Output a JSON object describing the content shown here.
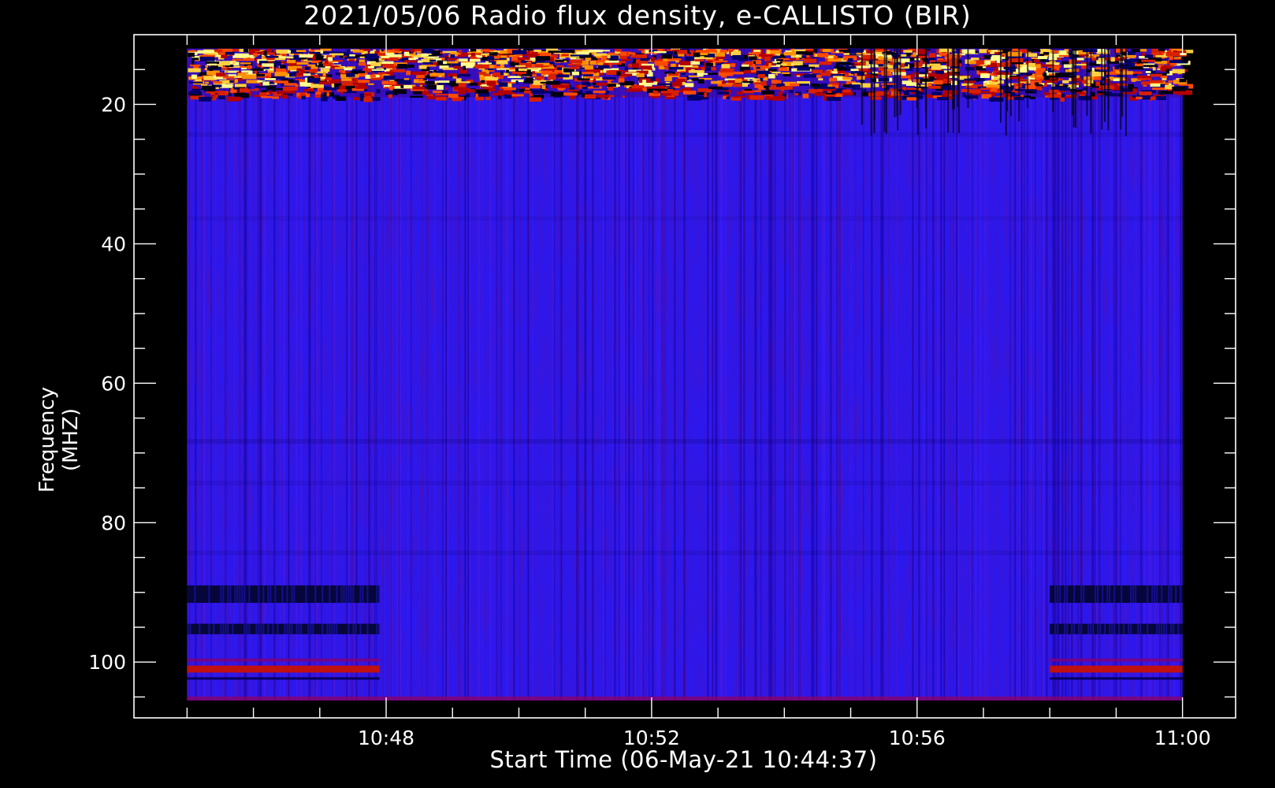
{
  "chart_data": {
    "type": "heatmap",
    "title": "2021/05/06  Radio flux density, e-CALLISTO (BIR)",
    "xlabel": "Start Time (06-May-21 10:44:37)",
    "ylabel": "Frequency (MHZ)",
    "x_ticks": [
      "10:48",
      "10:52",
      "10:56",
      "11:00"
    ],
    "x_tick_minutes": [
      648,
      652,
      656,
      660
    ],
    "x_data_range_minutes": [
      645.0,
      660.0
    ],
    "xlim_minutes": [
      644.2,
      660.8
    ],
    "y_ticks": [
      "20",
      "40",
      "60",
      "80",
      "100"
    ],
    "y_tick_values": [
      20,
      40,
      60,
      80,
      100
    ],
    "ylim": [
      10,
      108
    ],
    "y_data_range": [
      12,
      105.5
    ],
    "y_inverted": true,
    "grid": false,
    "colormap": [
      "#000000",
      "#1a00c8",
      "#2b13ff",
      "#b40000",
      "#ff3a00",
      "#ffb400",
      "#ffff90"
    ],
    "background_color": "#2a18f0",
    "features": [
      {
        "description": "bright intermittent emission band",
        "freq_range": [
          12,
          19
        ],
        "time_range": [
          645.0,
          660.0
        ],
        "intensity": "high"
      },
      {
        "description": "dark interference bands",
        "freq_range": [
          89,
          91.5
        ],
        "time_range": [
          645.0,
          647.9
        ],
        "intensity": "low"
      },
      {
        "description": "dark interference bands",
        "freq_range": [
          89,
          91.5
        ],
        "time_range": [
          658.0,
          660.0
        ],
        "intensity": "low"
      },
      {
        "description": "dark interference band",
        "freq_range": [
          94.5,
          96
        ],
        "time_range": [
          645.0,
          647.9
        ],
        "intensity": "low"
      },
      {
        "description": "dark interference band",
        "freq_range": [
          94.5,
          96
        ],
        "time_range": [
          658.0,
          660.0
        ],
        "intensity": "low"
      },
      {
        "description": "red emission line",
        "freq_range": [
          100.5,
          101.5
        ],
        "time_range": [
          645.0,
          647.9
        ],
        "intensity": "medium"
      },
      {
        "description": "red emission line",
        "freq_range": [
          100.5,
          101.5
        ],
        "time_range": [
          658.0,
          660.0
        ],
        "intensity": "medium"
      }
    ]
  }
}
